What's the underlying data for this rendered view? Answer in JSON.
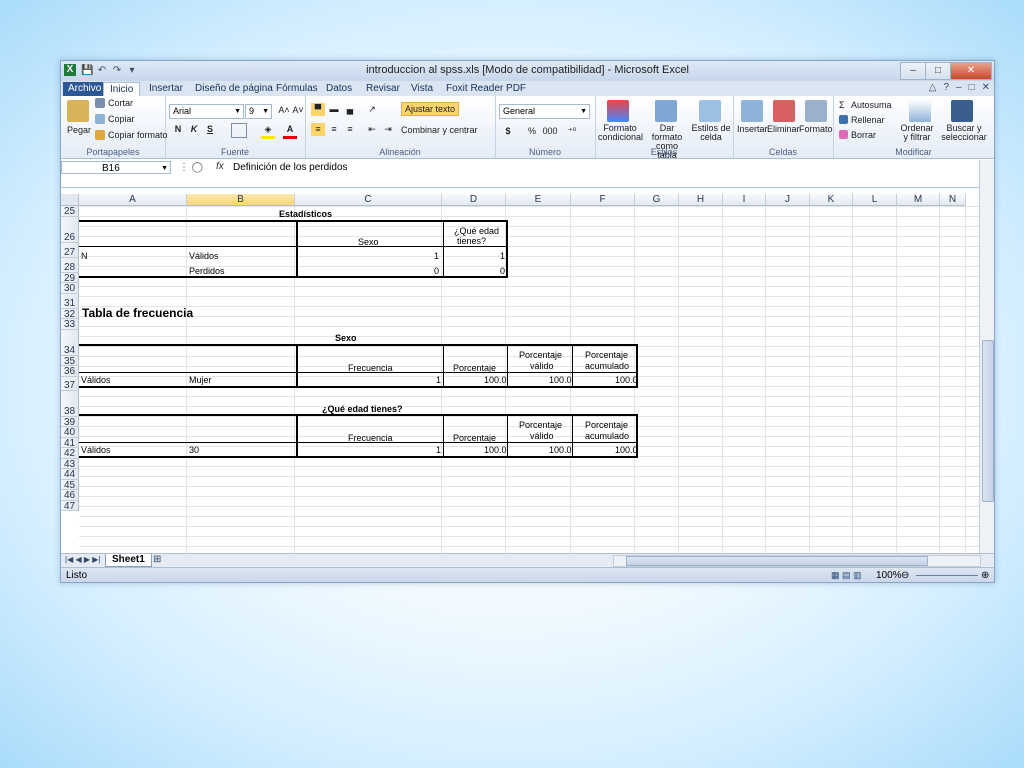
{
  "window": {
    "title": "introduccion al spss.xls  [Modo de compatibilidad]  -  Microsoft Excel",
    "app_icon": "X",
    "controls": [
      "–",
      "□",
      "✕"
    ]
  },
  "ribbon_tabs": [
    "Archivo",
    "Inicio",
    "Insertar",
    "Diseño de página",
    "Fórmulas",
    "Datos",
    "Revisar",
    "Vista",
    "Foxit Reader PDF"
  ],
  "ribbon": {
    "clipboard": {
      "paste": "Pegar",
      "cut": "Cortar",
      "copy": "Copiar",
      "format_painter": "Copiar formato",
      "label": "Portapapeles"
    },
    "font": {
      "name": "Arial",
      "size": "9",
      "bold": "N",
      "italic": "K",
      "underline": "S",
      "label": "Fuente"
    },
    "alignment": {
      "wrap": "Ajustar texto",
      "merge": "Combinar y centrar",
      "label": "Alineación"
    },
    "number": {
      "format": "General",
      "currency": "$",
      "percent": "%",
      "thousands": "000",
      "label": "Número"
    },
    "styles": {
      "conditional": "Formato condicional",
      "as_table": "Dar formato como tabla",
      "cell_styles": "Estilos de celda",
      "label": "Estilos"
    },
    "cells": {
      "insert": "Insertar",
      "delete": "Eliminar",
      "format": "Formato",
      "label": "Celdas"
    },
    "editing": {
      "autosum": "Autosuma",
      "fill": "Rellenar",
      "clear": "Borrar",
      "sort": "Ordenar y filtrar",
      "find": "Buscar y seleccionar",
      "label": "Modificar"
    }
  },
  "formula_bar": {
    "name_box": "B16",
    "fx": "fx",
    "formula": "Definición de los perdidos"
  },
  "columns": [
    "A",
    "B",
    "C",
    "D",
    "E",
    "F",
    "G",
    "H",
    "I",
    "J",
    "K",
    "L",
    "M",
    "N"
  ],
  "selected_column": "B",
  "rows": [
    "25",
    "26",
    "27",
    "28",
    "29",
    "30",
    "31",
    "32",
    "33",
    "34",
    "35",
    "36",
    "37",
    "38",
    "39",
    "40",
    "41",
    "42",
    "43",
    "44",
    "45",
    "46",
    "47"
  ],
  "cells": {
    "estadisticos_title": "Estadísticos",
    "sexo_header": "Sexo",
    "edad_header_1": "¿Qué edad",
    "edad_header_2": "tienes?",
    "n_label": "N",
    "validos": "Válidos",
    "perdidos": "Perdidos",
    "n_sexo_validos": "1",
    "n_edad_validos": "1",
    "n_sexo_perdidos": "0",
    "n_edad_perdidos": "0",
    "tabla_frecuencia": "Tabla de frecuencia",
    "sexo_title": "Sexo",
    "frecuencia": "Frecuencia",
    "porcentaje": "Porcentaje",
    "porc_valido_1": "Porcentaje",
    "porc_valido_2": "válido",
    "porc_acum_1": "Porcentaje",
    "porc_acum_2": "acumulado",
    "validos_2": "Válidos",
    "mujer": "Mujer",
    "freq_sexo": "1",
    "pct_sexo": "100.0",
    "pctv_sexo": "100.0",
    "pcta_sexo": "100.0",
    "edad_title": "¿Qué edad tienes?",
    "frecuencia_2": "Frecuencia",
    "porcentaje_2": "Porcentaje",
    "porc_valido_3": "Porcentaje",
    "porc_valido_4": "válido",
    "porc_acum_3": "Porcentaje",
    "porc_acum_4": "acumulado",
    "validos_3": "Válidos",
    "edad_30": "30",
    "freq_edad": "1",
    "pct_edad": "100.0",
    "pctv_edad": "100.0",
    "pcta_edad": "100.0"
  },
  "sheet_tabs": [
    "Sheet1"
  ],
  "status": {
    "ready": "Listo",
    "zoom": "100%"
  }
}
